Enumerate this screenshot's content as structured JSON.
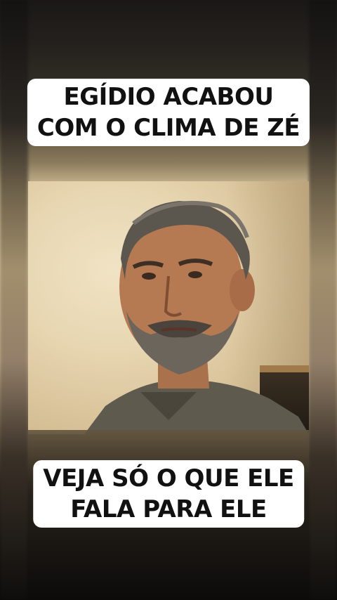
{
  "top_caption": {
    "line1": "EGÍDIO ACABOU",
    "line2": "COM O CLIMA DE ZÉ"
  },
  "bottom_caption": {
    "line1": "VEJA SÓ O QUE ELE",
    "line2": "FALA PARA ELE"
  },
  "colors": {
    "caption_bg": "#ffffff",
    "caption_text": "#111111",
    "background_dark": "#0d0c0b",
    "photo_wall": "#e7d6b1"
  }
}
